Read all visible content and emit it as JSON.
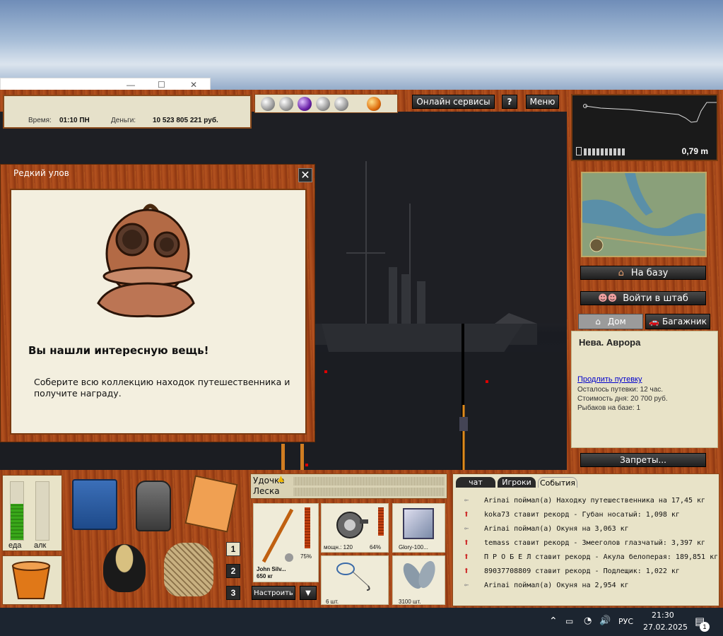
{
  "desktop": {
    "bg_window_controls": [
      "—",
      "☐",
      "✕"
    ]
  },
  "hud": {
    "time_label": "Время:",
    "time_value": "01:10 ПН",
    "money_label": "Деньги:",
    "money_value": "10 523 805 221 руб."
  },
  "top_buttons": {
    "online": "Онлайн сервисы",
    "help": "?",
    "menu": "Меню"
  },
  "depth": {
    "value": "0,79 m"
  },
  "popup": {
    "title": "Редкий улов",
    "headline": "Вы нашли интересную вещь!",
    "body": "Соберите всю коллекцию находок путешественника и получите награду."
  },
  "right_panel": {
    "to_base": "На базу",
    "to_hq": "Войти в штаб",
    "tab_home": "Дом",
    "tab_trunk": "Багажник",
    "location": "Нева. Аврора",
    "extend_link": "Продлить путевку",
    "info": [
      "Осталось путевки: 12 час.",
      "Стоимость дня: 20 700 руб.",
      "Рыбаков на базе: 1"
    ],
    "bans": "Запреты..."
  },
  "bottom_left": {
    "food_label": "еда",
    "alc_label": "алк",
    "food_level": 0.62,
    "alc_level": 0.0,
    "slots": [
      "1",
      "2",
      "3"
    ]
  },
  "tackle": {
    "rod_label": "Удочка",
    "line_label": "Леска",
    "rod_name": "John Silv...",
    "rod_weight": "650 кг",
    "rod_percent": "75%",
    "reel_power": "мощн.: 120",
    "reel_percent": "64%",
    "line_name": "Glory-100...",
    "hook_count": "6 шт.",
    "bait_count": "3100 шт.",
    "setup_button": "Настроить"
  },
  "events": {
    "tabs": [
      "чат",
      "Игроки",
      "События"
    ],
    "active_tab": "События",
    "items": [
      {
        "type": "catch",
        "text": "Arinai поймал(а) Находку путешественника на 17,45 кг"
      },
      {
        "type": "record",
        "text": "koka73 ставит рекорд - Губан носатый: 1,098 кг"
      },
      {
        "type": "catch",
        "text": "Arinai поймал(а) Окуня на 3,063 кг"
      },
      {
        "type": "record",
        "text": "temass ставит рекорд - Змееголов глазчатый: 3,397 кг"
      },
      {
        "type": "record",
        "text": "П Р О Б Е Л ставит рекорд - Акула белоперая: 189,851 кг"
      },
      {
        "type": "record",
        "text": "89037708809 ставит рекорд - Подлещик: 1,022 кг"
      },
      {
        "type": "catch",
        "text": "Arinai поймал(а) Окуня на 2,954 кг"
      }
    ]
  },
  "taskbar": {
    "lang": "РУС",
    "time": "21:30",
    "date": "27.02.2025",
    "notif_count": "1"
  },
  "colors": {
    "wood": "#a44618",
    "cream": "#f3efdf",
    "link": "#0000cc",
    "record_arrow": "#cc2222"
  }
}
